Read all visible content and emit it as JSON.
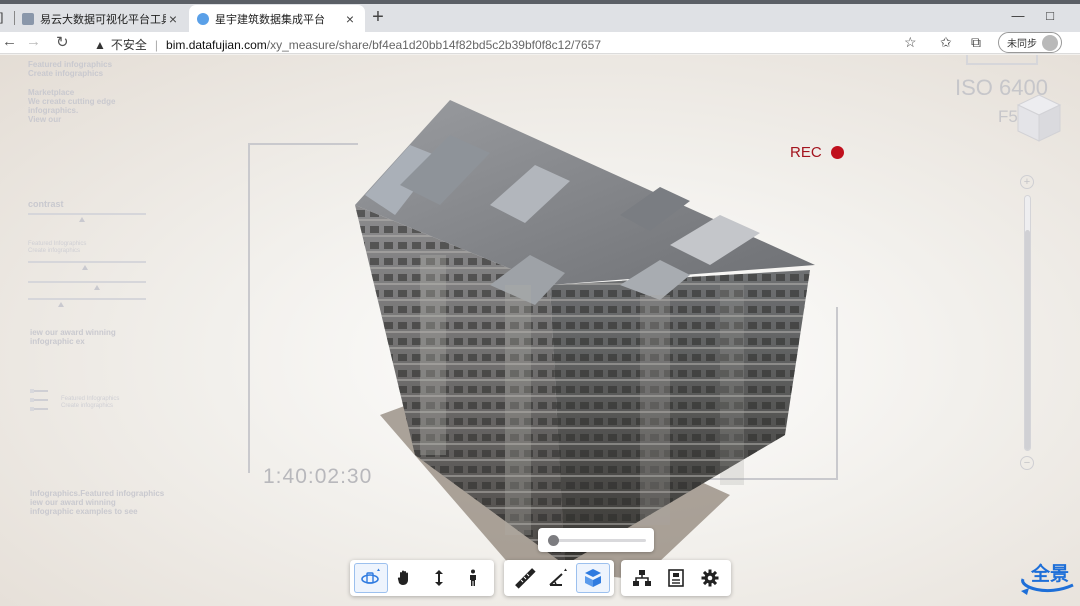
{
  "browser": {
    "tabs": [
      {
        "title": "易云大数据可视化平台工具",
        "active": false,
        "favicon_color": "#7c8fa8"
      },
      {
        "title": "星宇建筑数据集成平台",
        "active": true,
        "favicon_color": "#5aa0e8"
      }
    ],
    "tab_close": "×",
    "new_tab": "+",
    "left_glyph": "]",
    "window": {
      "minimize": "—",
      "maximize": "□"
    },
    "security_warning": "不安全",
    "url_host": "bim.datafujian.com",
    "url_path": "/xy_measure/share/bf4ea1d20bb14f82bd5c2b39bf0f8c12/7657",
    "sync_label": "未同步"
  },
  "hud": {
    "left_top": [
      "Featured infographics",
      "Create infographics"
    ],
    "left_market": [
      "Marketplace",
      "We create cutting edge",
      "infographics.",
      "View our"
    ],
    "contrast_label": "contrast",
    "left_small_1": [
      "Featured Infographics",
      "Create infographics"
    ],
    "left_award": [
      "iew our award winning",
      "infographic ex"
    ],
    "left_small_2": [
      "Featured Infographics",
      "Create infographics"
    ],
    "left_bottom": [
      "Infographics.Featured infographics",
      "iew our award winning",
      "infographic examples to see"
    ],
    "timecode": "1:40:02:30",
    "rec": "REC",
    "iso": "ISO 6400",
    "fstop": "F5.6",
    "zoom_in": "+",
    "zoom_out": "−"
  },
  "viewer": {
    "slider_fraction": 0.03,
    "pano_label": "全景"
  },
  "toolbar": {
    "groups": [
      [
        {
          "icon": "orbit-rotate-icon",
          "active": false
        },
        {
          "icon": "pan-hand-icon",
          "active": false
        },
        {
          "icon": "vertical-move-icon",
          "active": false
        },
        {
          "icon": "walk-person-icon",
          "active": false
        }
      ],
      [
        {
          "icon": "ruler-measure-icon",
          "active": false
        },
        {
          "icon": "angle-measure-icon",
          "active": false
        },
        {
          "icon": "section-box-icon",
          "active": true
        }
      ],
      [
        {
          "icon": "model-tree-icon",
          "active": false
        },
        {
          "icon": "properties-icon",
          "active": false
        },
        {
          "icon": "settings-gear-icon",
          "active": false
        }
      ]
    ]
  },
  "colors": {
    "accent": "#1e6fd8",
    "rec": "#c0101d",
    "hud_text": "#c9c9cf"
  }
}
